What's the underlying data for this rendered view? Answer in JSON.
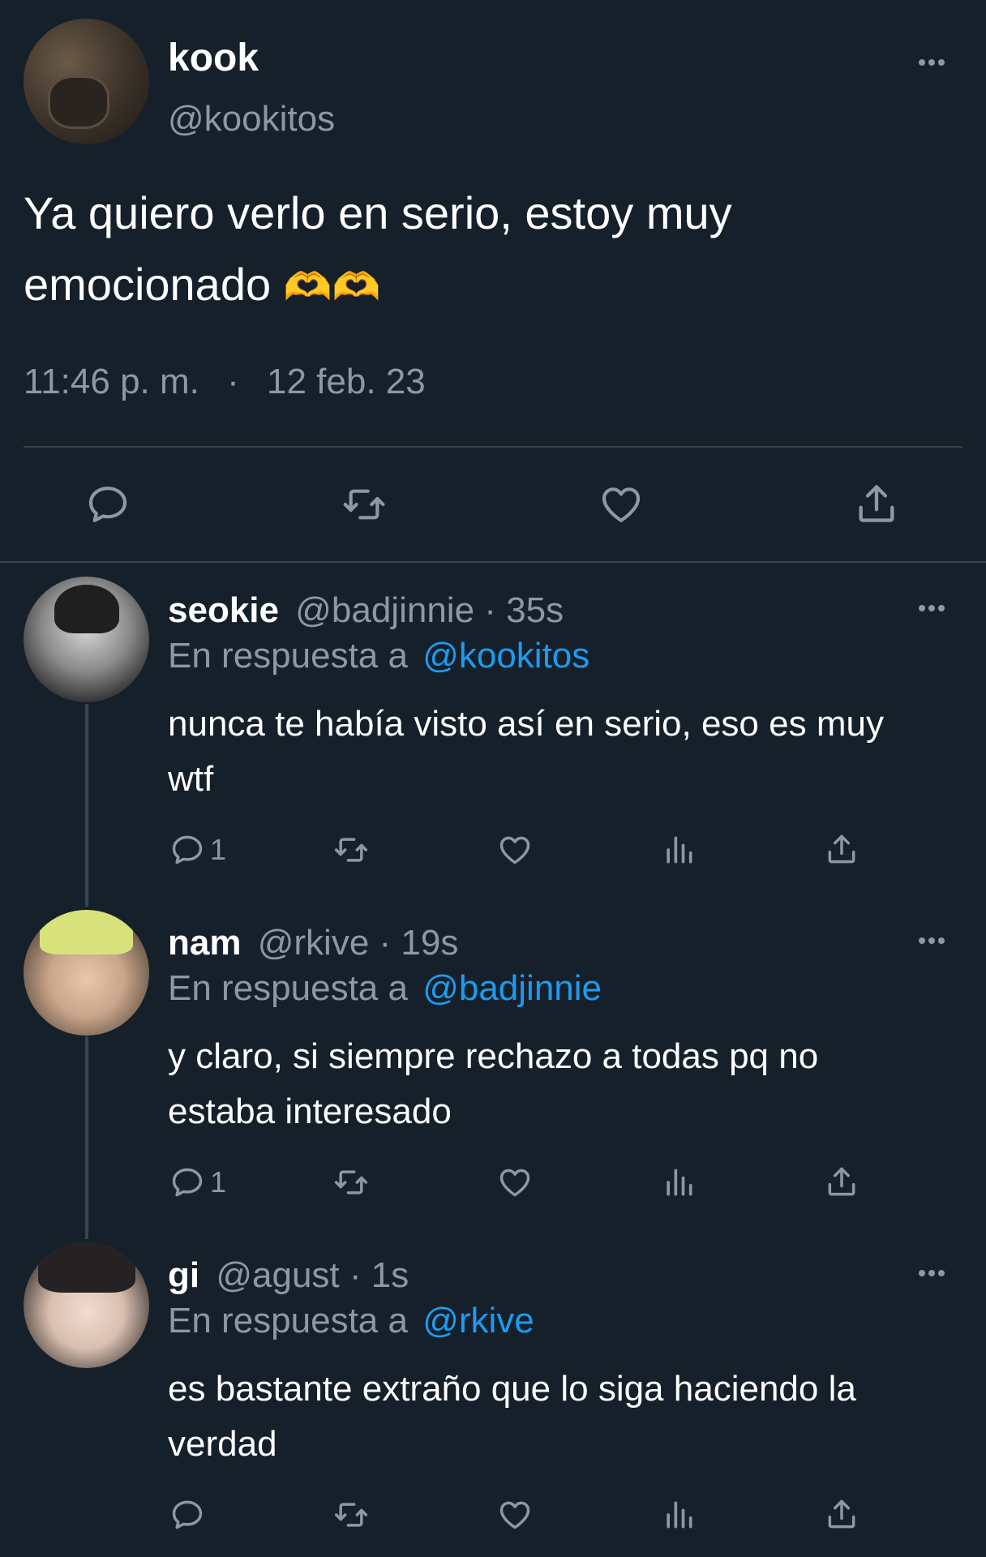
{
  "main_tweet": {
    "display_name": "kook",
    "handle": "@kookitos",
    "text_line1": "Ya quiero verlo en serio, estoy muy",
    "text_line2": "emocionado",
    "emoji": "🫶🫶",
    "time": "11:46 p. m.",
    "separator": "·",
    "date": "12 feb. 23"
  },
  "replies": [
    {
      "display_name": "seokie",
      "handle": "@badjinnie",
      "age": "· 35s",
      "reply_prefix": "En respuesta a",
      "reply_to": "@kookitos",
      "text_line1": "nunca te había visto así en serio, eso es muy",
      "text_line2": "wtf",
      "reply_count": "1"
    },
    {
      "display_name": "nam",
      "handle": "@rkive",
      "age": "· 19s",
      "reply_prefix": "En respuesta a",
      "reply_to": "@badjinnie",
      "text_line1": "y claro, si siempre rechazo a todas pq no",
      "text_line2": "estaba interesado",
      "reply_count": "1"
    },
    {
      "display_name": "gi",
      "handle": "@agust",
      "age": "· 1s",
      "reply_prefix": "En respuesta a",
      "reply_to": "@rkive",
      "text_line1": "es bastante extraño que lo siga haciendo la",
      "text_line2": "verdad",
      "reply_count": ""
    }
  ],
  "icons": [
    "more-icon",
    "reply-icon",
    "retweet-icon",
    "like-icon",
    "share-icon",
    "views-icon"
  ],
  "colors": {
    "background": "#15202b",
    "text": "#ffffff",
    "muted": "#8b98a5",
    "link": "#1d9bf0",
    "divider": "#38444d"
  }
}
